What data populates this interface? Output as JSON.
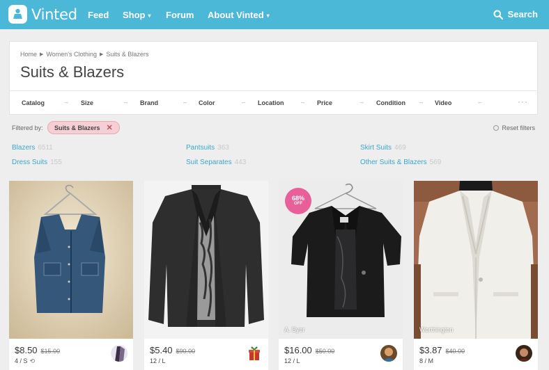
{
  "topnav": {
    "logo": "Vinted",
    "items": [
      {
        "label": "Feed",
        "has_caret": false
      },
      {
        "label": "Shop",
        "has_caret": true
      },
      {
        "label": "Forum",
        "has_caret": false
      },
      {
        "label": "About Vinted",
        "has_caret": true
      }
    ],
    "search_label": "Search",
    "bg_color": "#4ab8d6"
  },
  "breadcrumb": [
    "Home",
    "Women's Clothing",
    "Suits & Blazers"
  ],
  "page_title": "Suits & Blazers",
  "filters": [
    "Catalog",
    "Size",
    "Brand",
    "Color",
    "Location",
    "Price",
    "Condition",
    "Video"
  ],
  "filtered_by": {
    "label": "Filtered by:",
    "chip": "Suits & Blazers",
    "reset": "Reset filters"
  },
  "subcategories": [
    {
      "name": "Blazers",
      "count": "6511"
    },
    {
      "name": "Dress Suits",
      "count": "155"
    },
    {
      "name": "Pantsuits",
      "count": "363"
    },
    {
      "name": "Suit Separates",
      "count": "443"
    },
    {
      "name": "Skirt Suits",
      "count": "469"
    },
    {
      "name": "Other Suits & Blazers",
      "count": "569"
    }
  ],
  "products": [
    {
      "price": "$8.50",
      "old_price": "$15.00",
      "size": "4 / S",
      "swap": true,
      "brand": "",
      "discount": "",
      "discount_off": ""
    },
    {
      "price": "$5.40",
      "old_price": "$90.00",
      "size": "12 / L",
      "swap": false,
      "brand": "",
      "discount": "",
      "discount_off": ""
    },
    {
      "price": "$16.00",
      "old_price": "$50.00",
      "size": "12 / L",
      "swap": false,
      "brand": "A. Byer",
      "discount": "68%",
      "discount_off": "OFF"
    },
    {
      "price": "$3.87",
      "old_price": "$40.00",
      "size": "8 / M",
      "swap": false,
      "brand": "Worthington",
      "discount": "",
      "discount_off": ""
    }
  ],
  "icons": {
    "logo": "vinted-logo-icon",
    "search": "search-icon",
    "caret": "caret-down-icon",
    "more": "more-dots-icon",
    "close": "close-icon",
    "reset": "reset-icon",
    "swap": "swap-icon"
  },
  "colors": {
    "accent": "#4ab8d6",
    "link": "#3aa7c9",
    "chip_bg": "#f6cfd5",
    "discount": "#e8609a"
  }
}
